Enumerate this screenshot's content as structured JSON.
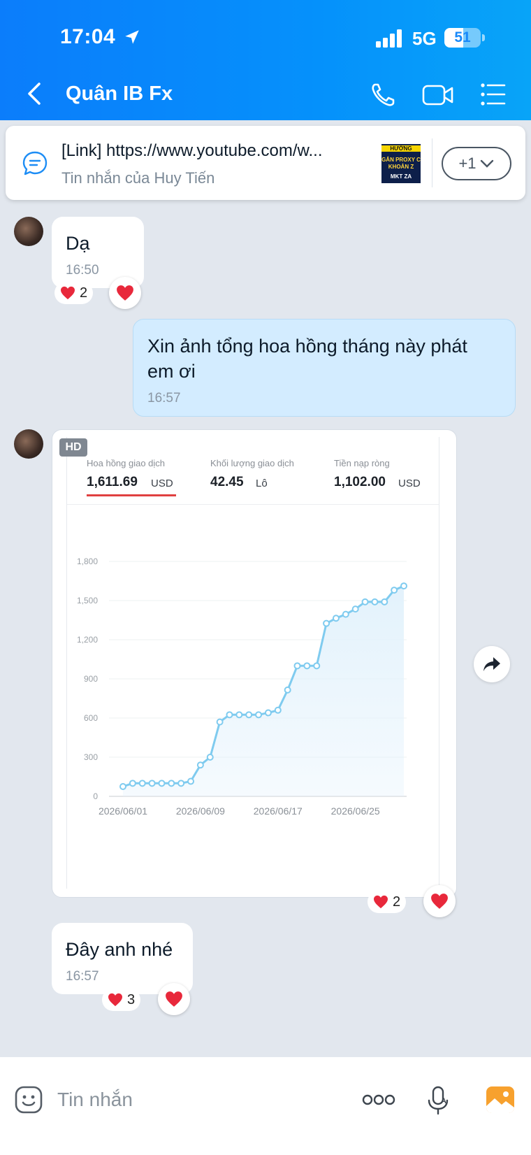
{
  "status_bar": {
    "time": "17:04",
    "network": "5G",
    "battery": "51",
    "battery_level": 0.51
  },
  "header": {
    "title": "Quân IB Fx"
  },
  "pinned": {
    "title": "[Link] https://www.youtube.com/w...",
    "subtitle": "Tin nhắn của Huy Tiến",
    "thumb_lines": [
      "HƯỚNG",
      "GẮN PROXY C",
      "KHOẢN Z",
      "MKT ZA"
    ],
    "more_label": "+1"
  },
  "messages": [
    {
      "text": "Dạ",
      "time": "16:50",
      "reaction_count": "2"
    },
    {
      "text_line1": "Xin ảnh tổng hoa hồng tháng này phát",
      "text_line2": "em ơi",
      "time": "16:57"
    },
    {
      "hd_label": "HD",
      "reaction_count": "2"
    },
    {
      "text": "Đây anh nhé",
      "time": "16:57",
      "reaction_count": "3"
    }
  ],
  "stats": [
    {
      "label": "Hoa hồng giao dịch",
      "value": "1,611.69",
      "unit": "USD"
    },
    {
      "label": "Khối lượng giao dịch",
      "value": "42.45",
      "unit": "Lô"
    },
    {
      "label": "Tiền nạp ròng",
      "value": "1,102.00",
      "unit": "USD"
    }
  ],
  "chart_data": {
    "type": "area",
    "ylim": [
      0,
      1800
    ],
    "yticks": [
      "0",
      "300",
      "600",
      "900",
      "1,200",
      "1,500",
      "1,800"
    ],
    "xticks": [
      "2026/06/01",
      "2026/06/09",
      "2026/06/17",
      "2026/06/25"
    ],
    "x": [
      "2026/06/01",
      "2026/06/02",
      "2026/06/03",
      "2026/06/04",
      "2026/06/05",
      "2026/06/06",
      "2026/06/07",
      "2026/06/08",
      "2026/06/09",
      "2026/06/10",
      "2026/06/11",
      "2026/06/12",
      "2026/06/13",
      "2026/06/14",
      "2026/06/15",
      "2026/06/16",
      "2026/06/17",
      "2026/06/18",
      "2026/06/19",
      "2026/06/20",
      "2026/06/21",
      "2026/06/22",
      "2026/06/23",
      "2026/06/24",
      "2026/06/25",
      "2026/06/26",
      "2026/06/27",
      "2026/06/28",
      "2026/06/29",
      "2026/06/30"
    ],
    "values": [
      75,
      100,
      100,
      100,
      100,
      100,
      100,
      115,
      240,
      300,
      570,
      625,
      625,
      625,
      625,
      640,
      660,
      815,
      1000,
      1000,
      1000,
      1325,
      1365,
      1395,
      1435,
      1490,
      1490,
      1490,
      1580,
      1612
    ],
    "colors": {
      "line": "#7fcbef",
      "fill": "#e3f2fc"
    },
    "grid": true
  },
  "composer": {
    "placeholder": "Tin nhắn"
  }
}
